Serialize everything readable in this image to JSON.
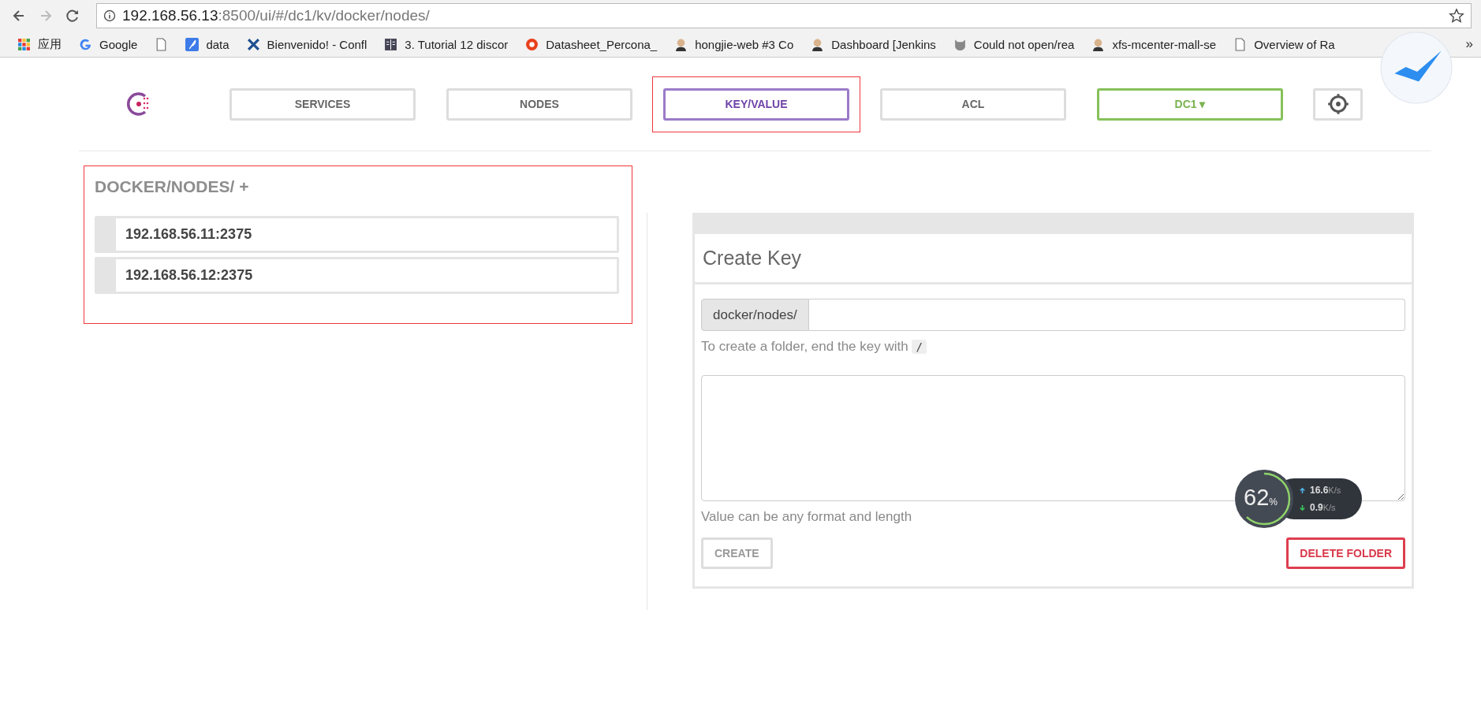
{
  "browser": {
    "url_host": "192.168.56.13",
    "url_path": ":8500/ui/#/dc1/kv/docker/nodes/",
    "bookmarks": [
      {
        "kind": "apps",
        "label": "应用"
      },
      {
        "kind": "google",
        "label": "Google"
      },
      {
        "kind": "page"
      },
      {
        "kind": "feather",
        "label": "data"
      },
      {
        "kind": "cross",
        "label": "Bienvenido! - Confl"
      },
      {
        "kind": "book",
        "label": "3. Tutorial 12 discor"
      },
      {
        "kind": "ring",
        "label": "Datasheet_Percona_"
      },
      {
        "kind": "figure",
        "label": "hongjie-web #3 Co"
      },
      {
        "kind": "figure",
        "label": "Dashboard [Jenkins"
      },
      {
        "kind": "cat",
        "label": "Could not open/rea"
      },
      {
        "kind": "figure",
        "label": "xfs-mcenter-mall-se"
      },
      {
        "kind": "page",
        "label": "Overview of Ra"
      }
    ],
    "more": "»"
  },
  "nav": {
    "tabs": [
      {
        "label": "SERVICES",
        "selected": false,
        "highlighted": false
      },
      {
        "label": "NODES",
        "selected": false,
        "highlighted": false
      },
      {
        "label": "KEY/VALUE",
        "selected": true,
        "highlighted": true
      },
      {
        "label": "ACL",
        "selected": false,
        "highlighted": false
      }
    ],
    "datacenter": {
      "label": "DC1",
      "caret": "▾"
    }
  },
  "keys": {
    "title": "DOCKER/NODES/ +",
    "highlighted": true,
    "items": [
      {
        "label": "192.168.56.11:2375"
      },
      {
        "label": "192.168.56.12:2375"
      }
    ]
  },
  "create_key": {
    "title": "Create Key",
    "prefix": "docker/nodes/",
    "key_hint": "To create a folder, end the key with",
    "key_hint_code": "/",
    "value_hint": "Value can be any format and length",
    "buttons": [
      {
        "label": "CREATE",
        "kind": "create"
      },
      {
        "label": "DELETE FOLDER",
        "kind": "danger"
      }
    ]
  },
  "monitor": {
    "percent": "62",
    "percent_unit": "%",
    "level": 0.62,
    "upload": "16.6",
    "upload_unit": "K/s",
    "download": "0.9",
    "download_unit": "K/s"
  }
}
